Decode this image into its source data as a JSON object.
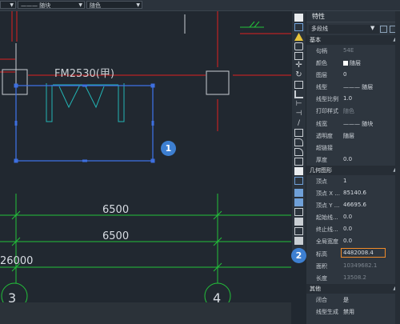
{
  "toolbar": {
    "linetype_label": "——— 随块",
    "color_label": "随色"
  },
  "canvas": {
    "door_label": "FM2530(甲)",
    "dim1": "6500",
    "dim2": "6500",
    "dim3": "26000",
    "axis_a": "3",
    "axis_b": "4"
  },
  "badges": {
    "b1": "1",
    "b2": "2"
  },
  "panel": {
    "title": "特性",
    "selector": "多段线",
    "sections": {
      "basic": "基本",
      "geometry": "几何图形",
      "other": "其他"
    },
    "basic_rows": [
      {
        "label": "句柄",
        "value": "54E",
        "dim": true
      },
      {
        "label": "颜色",
        "value": "随层",
        "swatch": true
      },
      {
        "label": "图层",
        "value": "0"
      },
      {
        "label": "线型",
        "value": "——— 随层"
      },
      {
        "label": "线型比例",
        "value": "1.0"
      },
      {
        "label": "打印样式",
        "value": "随色",
        "dim": true
      },
      {
        "label": "线宽",
        "value": "——— 随块"
      },
      {
        "label": "透明度",
        "value": "随层"
      },
      {
        "label": "超链接",
        "value": ""
      },
      {
        "label": "厚度",
        "value": "0.0"
      }
    ],
    "geometry_rows": [
      {
        "label": "顶点",
        "value": "1"
      },
      {
        "label": "顶点 X ...",
        "value": "85140.6"
      },
      {
        "label": "顶点 Y ...",
        "value": "46695.6"
      },
      {
        "label": "起始线...",
        "value": "0.0"
      },
      {
        "label": "终止线...",
        "value": "0.0"
      },
      {
        "label": "全局宽度",
        "value": "0.0"
      },
      {
        "label": "标高",
        "value": "4482008.4",
        "highlight": true
      },
      {
        "label": "面积",
        "value": "10349682.1",
        "dim": true
      },
      {
        "label": "长度",
        "value": "13508.2",
        "dim": true
      }
    ],
    "other_rows": [
      {
        "label": "闭合",
        "value": "是"
      },
      {
        "label": "线型生成",
        "value": "禁用"
      }
    ]
  },
  "colors": {
    "highlight": "#f08b2a",
    "badge": "#3d7fd1",
    "wall": "#e02020",
    "door": "#22b5b5",
    "dim": "#23c23a"
  }
}
